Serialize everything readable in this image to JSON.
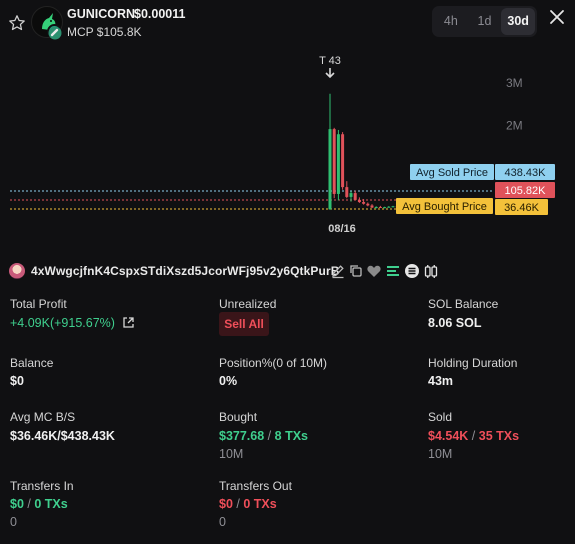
{
  "header": {
    "token_name": "GUNICORN",
    "token_price": "$0.00011",
    "mcp": "MCP $105.8K",
    "timeframes": [
      "4h",
      "1d",
      "30d"
    ],
    "active_timeframe": "30d",
    "icons": {
      "favorite": "star-icon",
      "close": "close-icon",
      "mcp": "pill-icon"
    }
  },
  "chart": {
    "trade_marker": "T 43",
    "x_tick": "08/16",
    "y_ticks": [
      "3M",
      "2M",
      "1M"
    ],
    "price_tags": {
      "avg_sold_label": "Avg Sold Price",
      "avg_sold_value": "438.43K",
      "current_value": "105.82K",
      "avg_bought_label": "Avg Bought Price",
      "avg_bought_value": "36.46K"
    },
    "colors": {
      "up": "#2fbf71",
      "down": "#e0525a",
      "sold_tag": "#8fd0ef",
      "current_tag": "#e0525a",
      "bought_tag": "#f3c13a"
    }
  },
  "chart_data": {
    "type": "candlestick",
    "x_tick_labels": [
      "08/16"
    ],
    "y_tick_labels": [
      "3M",
      "2M",
      "1M"
    ],
    "ylim": [
      0,
      3400000
    ],
    "reference_lines": [
      {
        "label": "Avg Sold Price",
        "value": 438430
      },
      {
        "label": "Current",
        "value": 105820
      },
      {
        "label": "Avg Bought Price",
        "value": 36460
      }
    ],
    "candles": [
      {
        "o": 40000,
        "h": 2750000,
        "l": 30000,
        "c": 1920000
      },
      {
        "o": 1920000,
        "h": 1950000,
        "l": 300000,
        "c": 400000
      },
      {
        "o": 400000,
        "h": 1900000,
        "l": 250000,
        "c": 1800000
      },
      {
        "o": 1800000,
        "h": 1850000,
        "l": 500000,
        "c": 560000
      },
      {
        "o": 560000,
        "h": 700000,
        "l": 300000,
        "c": 330000
      },
      {
        "o": 330000,
        "h": 460000,
        "l": 220000,
        "c": 420000
      },
      {
        "o": 420000,
        "h": 480000,
        "l": 250000,
        "c": 260000
      },
      {
        "o": 260000,
        "h": 320000,
        "l": 190000,
        "c": 210000
      },
      {
        "o": 210000,
        "h": 280000,
        "l": 150000,
        "c": 170000
      },
      {
        "o": 170000,
        "h": 200000,
        "l": 110000,
        "c": 130000
      },
      {
        "o": 130000,
        "h": 160000,
        "l": 70000,
        "c": 80000
      },
      {
        "o": 80000,
        "h": 110000,
        "l": 60000,
        "c": 95000
      },
      {
        "o": 95000,
        "h": 120000,
        "l": 70000,
        "c": 75000
      },
      {
        "o": 75000,
        "h": 100000,
        "l": 65000,
        "c": 90000
      },
      {
        "o": 90000,
        "h": 115000,
        "l": 80000,
        "c": 100000
      },
      {
        "o": 100000,
        "h": 120000,
        "l": 90000,
        "c": 110000
      },
      {
        "o": 110000,
        "h": 125000,
        "l": 95000,
        "c": 105820
      }
    ],
    "annotations": [
      {
        "text": "T 43",
        "candle": 0
      }
    ]
  },
  "wallet": {
    "address": "4xWwgcjfnK4CspxSTdiXszd5JcorWFj95v2y6QtkPurB",
    "icons": [
      "edit-icon",
      "copy-icon",
      "heart-icon",
      "menu-icon",
      "solana-icon",
      "wallet-icon"
    ]
  },
  "stats": {
    "total_profit_label": "Total Profit",
    "total_profit_value": "+4.09K(+915.67%)",
    "unrealized_label": "Unrealized",
    "sell_all": "Sell All",
    "sol_balance_label": "SOL Balance",
    "sol_balance_value": "8.06 SOL",
    "balance_label": "Balance",
    "balance_value": "$0",
    "position_label": "Position%(0 of 10M)",
    "position_value": "0%",
    "holding_label": "Holding Duration",
    "holding_value": "43m",
    "avg_mc_label": "Avg MC B/S",
    "avg_mc_value": "$36.46K/$438.43K",
    "bought_label": "Bought",
    "bought_amount": "$377.68",
    "bought_sep": "/",
    "bought_txs": "8 TXs",
    "bought_tokens": "10M",
    "sold_label": "Sold",
    "sold_amount": "$4.54K",
    "sold_sep": "/",
    "sold_txs": "35 TXs",
    "sold_tokens": "10M",
    "transfers_in_label": "Transfers In",
    "transfers_in_amount": "$0",
    "transfers_in_sep": "/",
    "transfers_in_txs": "0 TXs",
    "transfers_in_tokens": "0",
    "transfers_out_label": "Transfers Out",
    "transfers_out_amount": "$0",
    "transfers_out_sep": "/",
    "transfers_out_txs": "0 TXs",
    "transfers_out_tokens": "0"
  }
}
